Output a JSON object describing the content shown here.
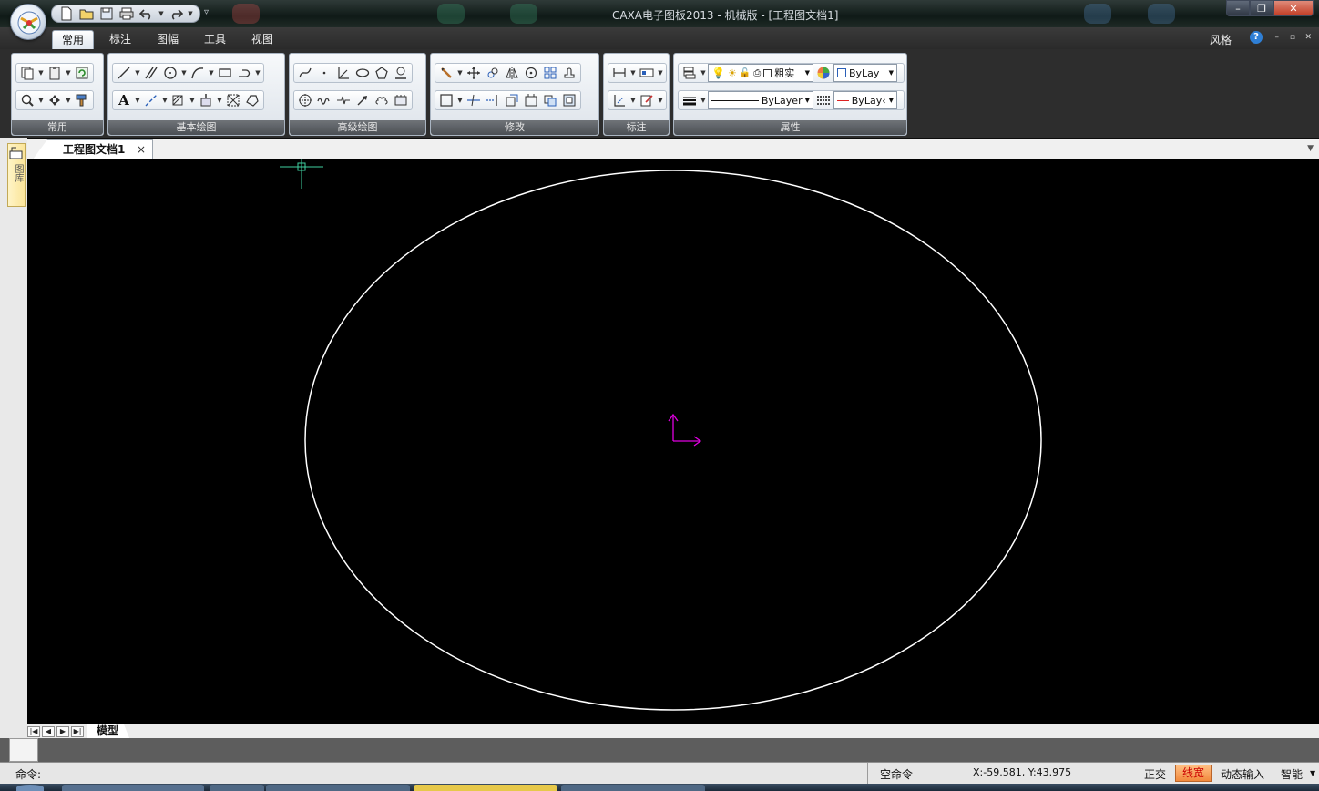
{
  "window": {
    "title": "CAXA电子图板2013 - 机械版 - [工程图文档1]",
    "controls": {
      "minimize": "–",
      "maximize": "❐",
      "close": "✕"
    }
  },
  "quick_access": {
    "icons": [
      "new-file-icon",
      "open-folder-icon",
      "save-icon",
      "print-icon",
      "undo-icon",
      "redo-icon"
    ],
    "more_label": "▿"
  },
  "ribbon": {
    "tabs": [
      "常用",
      "标注",
      "图幅",
      "工具",
      "视图"
    ],
    "active_tab": "常用",
    "style_menu": "风格",
    "help_label": "?",
    "mini_controls": {
      "minimize": "–",
      "restore": "▫",
      "close": "✕"
    },
    "groups": {
      "common": {
        "label": "常用"
      },
      "basic_draw": {
        "label": "基本绘图"
      },
      "advanced_draw": {
        "label": "高级绘图"
      },
      "modify": {
        "label": "修改"
      },
      "dimension": {
        "label": "标注"
      },
      "properties": {
        "label": "属性",
        "lineweight_combo": "粗实",
        "color_combo": "ByLay",
        "linetype_combo": "ByLayer",
        "linecolor_combo": "ByLay‹"
      }
    }
  },
  "left_panel": {
    "tab_label": "图库"
  },
  "document": {
    "tab_label": "工程图文档1",
    "close_label": "×",
    "menu_arrow": "▼"
  },
  "canvas": {
    "background": "#000000",
    "entity_color": "#ffffff",
    "cursor_color": "#3fd0a0",
    "ucs_color": "#e000e0",
    "entities": [
      {
        "type": "ellipse",
        "label": "white ellipse"
      }
    ]
  },
  "layout_tabs": {
    "nav": [
      "|◀",
      "◀",
      "▶",
      "▶|"
    ],
    "tabs": [
      "模型"
    ]
  },
  "command": {
    "prompt": "命令:"
  },
  "status": {
    "command_state": "空命令",
    "coordinates": "X:-59.581, Y:43.975",
    "ortho": "正交",
    "lineweight": "线宽",
    "dynamic_input": "动态输入",
    "smart": "智能"
  }
}
